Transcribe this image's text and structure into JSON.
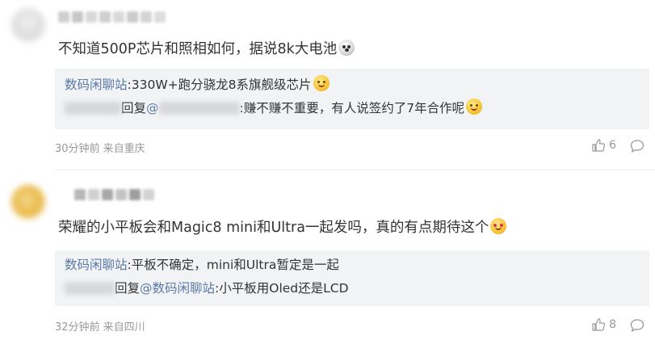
{
  "comments": [
    {
      "content": "不知道500P芯片和照相如何，据说8k大电池",
      "content_emoji": "shock-face",
      "replies": [
        {
          "author": "数码闲聊站",
          "text": ":330W+跑分骁龙8系旗舰级芯片",
          "emoji": "smile-face"
        },
        {
          "reply_word": "回复",
          "mention": "@",
          "text": ":赚不赚不重要，有人说签约了7年合作呢",
          "emoji": "laugh-face"
        }
      ],
      "meta": "30分钟前 来自重庆",
      "likes": "6"
    },
    {
      "content": "荣耀的小平板会和Magic8 mini和Ultra一起发吗，真的有点期待这个",
      "content_emoji": "heart-eyes-face",
      "replies": [
        {
          "author": "数码闲聊站",
          "text": ":平板不确定，mini和Ultra暂定是一起"
        },
        {
          "reply_word": "回复",
          "mention": "@数码闲聊站",
          "text": ":小平板用Oled还是LCD"
        }
      ],
      "meta": "32分钟前 来自四川",
      "likes": "8"
    }
  ],
  "colors": {
    "link": "#5b7aa8",
    "meta": "#999999",
    "reply_bg": "#f2f3f5"
  }
}
